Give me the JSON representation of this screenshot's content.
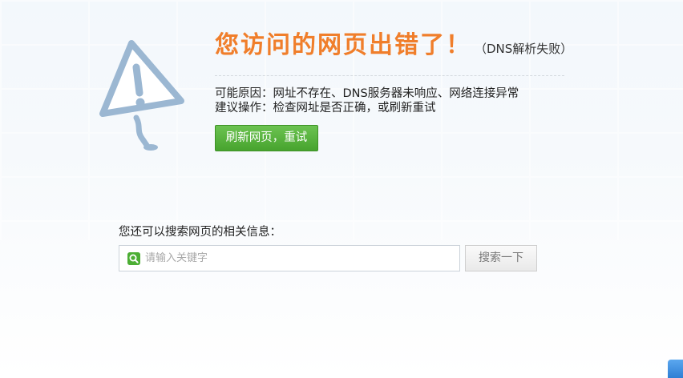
{
  "error": {
    "title": "您访问的网页出错了！",
    "subtitle": "（DNS解析失败）",
    "reason_line1": "可能原因：网址不存在、DNS服务器未响应、网络连接异常",
    "reason_line2": "建议操作：检查网址是否正确，或刷新重试",
    "refresh_label": "刷新网页，重试"
  },
  "search": {
    "prompt": "您还可以搜索网页的相关信息：",
    "placeholder": "请输入关键字",
    "button_label": "搜索一下"
  },
  "colors": {
    "title": "#f07e2b",
    "refresh_button": "#4cae34",
    "warning_icon": "#9bb7d2"
  },
  "icons": {
    "warning": "warning-sign-icon",
    "search": "search-icon",
    "corner": "download-corner-icon"
  }
}
